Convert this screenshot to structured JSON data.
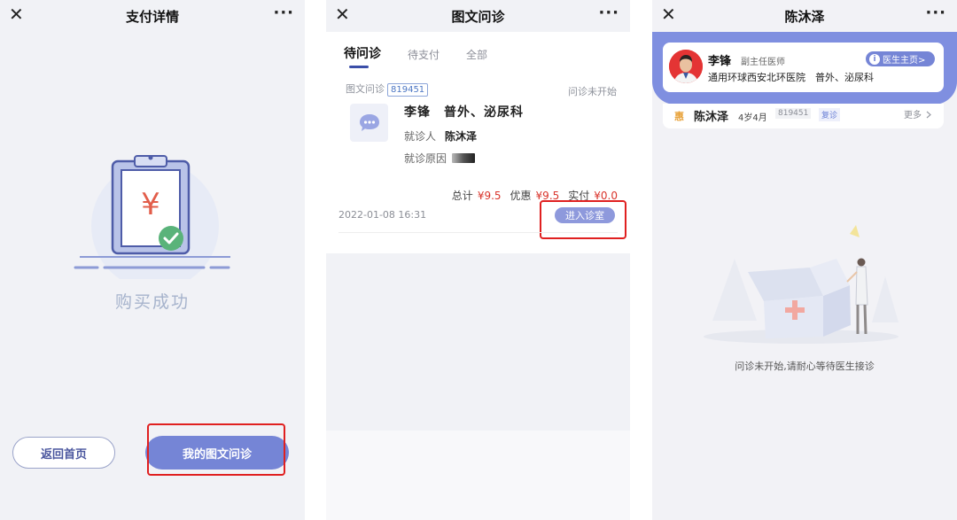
{
  "panel1": {
    "nav": {
      "title": "支付详情",
      "close": "✕",
      "more": "···"
    },
    "success_text": "购买成功",
    "currency_symbol": "¥",
    "home_button": "返回首页",
    "my_consult_button": "我的图文问诊"
  },
  "panel2": {
    "nav": {
      "title": "图文问诊",
      "close": "✕",
      "more": "···"
    },
    "tabs": [
      "待问诊",
      "待支付",
      "全部"
    ],
    "order": {
      "type": "图文问诊",
      "id": "819451",
      "status": "问诊未开始",
      "doctor": "李锋　普外、泌尿科",
      "patient_label": "就诊人",
      "patient_name": "陈沐泽",
      "reason_label": "就诊原因",
      "total_label": "总计",
      "total": "¥9.5",
      "discount_label": "优惠",
      "discount": "¥9.5",
      "paid_label": "实付",
      "paid": "¥0.0",
      "date": "2022-01-08 16:31",
      "enter_button": "进入诊室"
    }
  },
  "panel3": {
    "nav": {
      "title": "陈沐泽",
      "close": "✕",
      "more": "···"
    },
    "doctor": {
      "name": "李锋",
      "title": "副主任医师",
      "hospital": "通用环球西安北环医院　普外、泌尿科",
      "homepage_button": "医生主页>",
      "info_glyph": "i"
    },
    "patient": {
      "badge": "惠",
      "name": "陈沐泽",
      "age": "4岁4月",
      "id": "819451",
      "visit_type": "复诊",
      "more": "更多"
    },
    "waiting_text": "问诊未开始,请耐心等待医生接诊"
  },
  "colors": {
    "accent": "#7585d6",
    "price_red": "#d9342b",
    "highlight_box": "#e02020"
  }
}
